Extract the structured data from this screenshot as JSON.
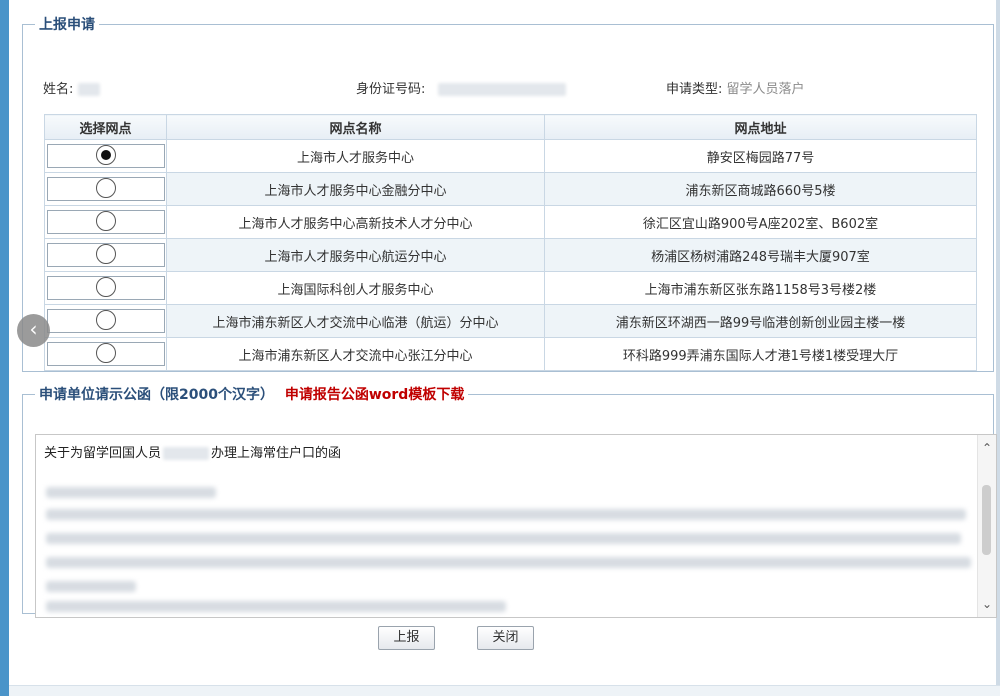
{
  "section1": {
    "title": "上报申请",
    "name_label": "姓名:",
    "id_label": "身份证号码:",
    "type_label": "申请类型:",
    "type_value": "留学人员落户"
  },
  "table": {
    "headers": [
      "选择网点",
      "网点名称",
      "网点地址"
    ],
    "rows": [
      {
        "name": "上海市人才服务中心",
        "address": "静安区梅园路77号",
        "selected": true
      },
      {
        "name": "上海市人才服务中心金融分中心",
        "address": "浦东新区商城路660号5楼",
        "selected": false
      },
      {
        "name": "上海市人才服务中心高新技术人才分中心",
        "address": "徐汇区宜山路900号A座202室、B602室",
        "selected": false
      },
      {
        "name": "上海市人才服务中心航运分中心",
        "address": "杨浦区杨树浦路248号瑞丰大厦907室",
        "selected": false
      },
      {
        "name": "上海国际科创人才服务中心",
        "address": "上海市浦东新区张东路1158号3号楼2楼",
        "selected": false
      },
      {
        "name": "上海市浦东新区人才交流中心临港（航运）分中心",
        "address": "浦东新区环湖西一路99号临港创新创业园主楼一楼",
        "selected": false
      },
      {
        "name": "上海市浦东新区人才交流中心张江分中心",
        "address": "环科路999弄浦东国际人才港1号楼1楼受理大厅",
        "selected": false
      }
    ]
  },
  "section2": {
    "title": "申请单位请示公函（限2000个汉字）",
    "template_link": "申请报告公函word模板下载",
    "letter_prefix": "关于为留学回国人员",
    "letter_suffix": "办理上海常住户口的函"
  },
  "icons": {
    "prev": "‹",
    "scroll_up": "⌃",
    "scroll_down": "⌄"
  },
  "buttons": {
    "submit": "上报",
    "close": "关闭"
  },
  "colors": {
    "legend": "#2b4f7a",
    "link_red": "#c00000",
    "rail": "#4a94c9"
  }
}
